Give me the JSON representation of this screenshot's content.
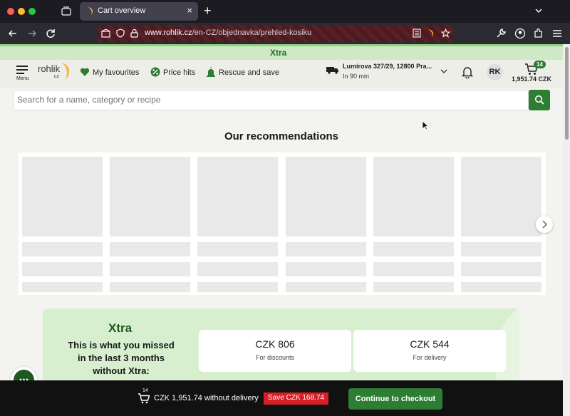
{
  "browser": {
    "tab_title": "Cart overview",
    "url_domain": "www.rohlik.cz",
    "url_path": "/en-CZ/objednavka/prehled-kosiku"
  },
  "banner": {
    "xtra_label": "Xtra"
  },
  "header": {
    "menu_label": "Menu",
    "logo_text": "rohlik",
    "logo_suffix": ".cz",
    "nav": [
      {
        "label": "My favourites",
        "icon": "heart-icon"
      },
      {
        "label": "Price hits",
        "icon": "percent-badge-icon"
      },
      {
        "label": "Rescue and save",
        "icon": "siren-icon"
      }
    ],
    "address": "Lumírova 327/29, 12800 Pra...",
    "delivery_time": "In 90 min",
    "avatar_initials": "RK",
    "cart_count": "14",
    "cart_total": "1,951.74 CZK"
  },
  "search": {
    "placeholder": "Search for a name, category or recipe"
  },
  "recommendations": {
    "title": "Our recommendations"
  },
  "xtra_panel": {
    "logo": "Xtra",
    "missed_text": "This is what you missed in the last 3 months without Xtra:",
    "cards": [
      {
        "amount": "CZK 806",
        "label": "For discounts"
      },
      {
        "amount": "CZK 544",
        "label": "For delivery"
      }
    ]
  },
  "checkout": {
    "count": "14",
    "total_text": "CZK 1,951.74 without delivery",
    "save_text": "Save CZK 168.74",
    "button_label": "Continue to checkout"
  },
  "colors": {
    "brand_green": "#2e7d32",
    "save_red": "#d81f26"
  }
}
